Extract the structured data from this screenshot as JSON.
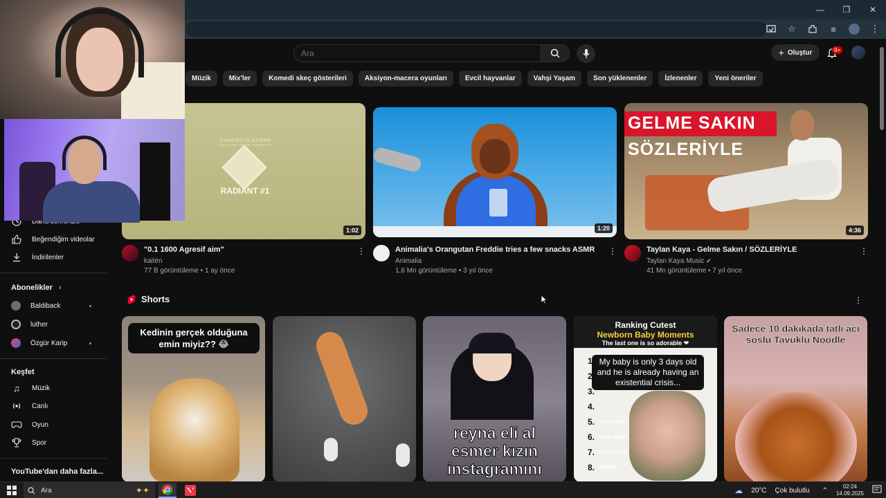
{
  "search": {
    "placeholder": "Ara"
  },
  "header": {
    "create_label": "Oluştur",
    "notif_badge": "9+"
  },
  "chips": [
    "Müzik",
    "Mix'ler",
    "Komedi skeç gösterileri",
    "Aksiyon-macera oyunları",
    "Evcil hayvanlar",
    "Vahşi Yaşam",
    "Son yüklenenler",
    "İzlenenler",
    "Yeni öneriler"
  ],
  "sidebar": {
    "later": "Daha sonra izle",
    "liked": "Beğendiğim videolar",
    "downloads": "İndirilenler",
    "subs_title": "Abonelikler",
    "subs": [
      "Baldiback",
      "luther",
      "Özgür Karip"
    ],
    "explore_title": "Keşfet",
    "explore": [
      "Müzik",
      "Canlı",
      "Oyun",
      "Spor"
    ],
    "more_title": "YouTube'dan daha fazla..."
  },
  "videos": [
    {
      "title": "\"0.1 1600 Agresif aim\"",
      "channel": "kaitén",
      "stats": "77 B görüntüleme • 1 ay önce",
      "duration": "1:02",
      "thumb_text1": "CONGRATULATIONS",
      "thumb_text1b": "YOU HAVE BEEN PROMOTED",
      "thumb_text2": "RADIANT #1"
    },
    {
      "title": "Animalia's Orangutan Freddie tries a few snacks ASMR",
      "channel": "Animalia",
      "stats": "1,6 Mn görüntüleme • 3 yıl önce",
      "duration": "1:20"
    },
    {
      "title": "Taylan Kaya - Gelme Sakın / SÖZLERİYLE",
      "channel": "Taylan Kaya Music",
      "stats": "41 Mn görüntüleme • 7 yıl önce",
      "duration": "4:36",
      "thumb_line1": "GELME SAKIN",
      "thumb_line2": "SÖZLERİYLE"
    }
  ],
  "shorts": {
    "title": "Shorts",
    "s1_caption": "Kedinin gerçek olduğuna emin miyiz?? 😂",
    "s3_line1": "reyna eli al",
    "s3_line2": "esmer kızın",
    "s3_line3": "instagramını",
    "s4_l1": "Ranking Cutest",
    "s4_l2": "Newborn Baby Moments",
    "s4_l3": "The last one is so adorable ❤",
    "s4_bubble": "My baby is only 3 days old and he is already having an existential crisis...",
    "s4_nums": [
      "1.",
      "2.",
      "3.",
      "4.",
      "5.",
      "6.",
      "7.",
      "8."
    ],
    "s4_caps": [
      "The thinker",
      "Cover blown",
      "Excuse me?",
      "Hiiiiiiiiiii"
    ],
    "s5_caption": "Sadece 10 dakikada tatlı acı soslu Tavuklu Noodle"
  },
  "taskbar": {
    "search": "Ara",
    "weather": "20°C",
    "weather_text": "Çok bulutlu",
    "time": "02:24",
    "date": "14.09.2025"
  }
}
